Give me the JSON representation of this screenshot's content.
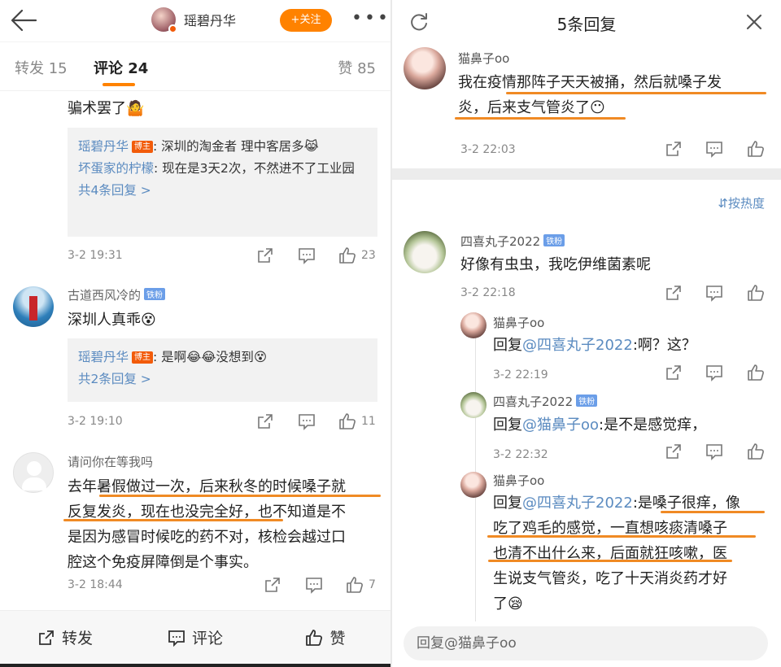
{
  "left": {
    "header": {
      "profile_name": "瑶碧丹华",
      "follow_label": "+关注"
    },
    "tabs": {
      "repost": "转发 15",
      "comment": "评论 24",
      "like": "赞 85"
    },
    "cut_line": "骗术罢了🤷",
    "comment1": {
      "replies": [
        {
          "name": "瑶碧丹华",
          "badge": "博主",
          "text": ": 深圳的淘金者 理中客居多😹"
        },
        {
          "name": "坏蛋家的柠檬",
          "text": ": 现在是3天2次，不然进不了工业园"
        }
      ],
      "more": "共4条回复 >",
      "time": "3-2 19:31",
      "likes": "23"
    },
    "comment2": {
      "user": "古道西风冷的",
      "badge": "铁粉",
      "text": "深圳人真乖😵",
      "reply": {
        "name": "瑶碧丹华",
        "badge": "博主",
        "text": ": 是啊😂😂没想到😵"
      },
      "more": "共2条回复 >",
      "time": "3-2 19:10",
      "likes": "11"
    },
    "comment3": {
      "user": "请问你在等我吗",
      "lines": [
        "去年暑假做过一次，后来秋冬的时候嗓子就",
        "反复发炎，现在也没完全好，也不知道是不",
        "是因为感冒时候吃的药不对，核检会越过口",
        "腔这个免疫屏障倒是个事实。"
      ],
      "time": "3-2 18:44",
      "likes": "7"
    },
    "bottom": {
      "repost": "转发",
      "comment": "评论",
      "like": "赞"
    }
  },
  "right": {
    "title": "5条回复",
    "root": {
      "user": "猫鼻子oo",
      "lines": [
        "我在疫情那阵子天天被捅，然后就嗓子发",
        "炎，后来支气管炎了😶"
      ],
      "time": "3-2 22:03"
    },
    "sort": "按热度",
    "thread": {
      "user": "四喜丸子2022",
      "badge": "铁粉",
      "text": "好像有虫虫，我吃伊维菌素呢",
      "time": "3-2 22:18"
    },
    "replies": [
      {
        "user": "猫鼻子oo",
        "prefix": "回复",
        "at": "@四喜丸子2022",
        "text": ":啊？这？",
        "time": "3-2 22:19"
      },
      {
        "user": "四喜丸子2022",
        "badge": "铁粉",
        "prefix": "回复",
        "at": "@猫鼻子oo",
        "text": ":是不是感觉痒，",
        "time": "3-2 22:32"
      },
      {
        "user": "猫鼻子oo",
        "prefix": "回复",
        "at": "@四喜丸子2022",
        "text": ":是嗓子很痒，像",
        "more_lines": [
          "吃了鸡毛的感觉，一直想咳痰清嗓子",
          "也清不出什么来，后面就狂咳嗽，医",
          "生说支气管炎，吃了十天消炎药才好",
          "了😪"
        ]
      }
    ],
    "input_placeholder": "回复@猫鼻子oo"
  },
  "colors": {
    "accent": "#ff8200",
    "link": "#5b8bc0",
    "underline": "#f08a24"
  }
}
